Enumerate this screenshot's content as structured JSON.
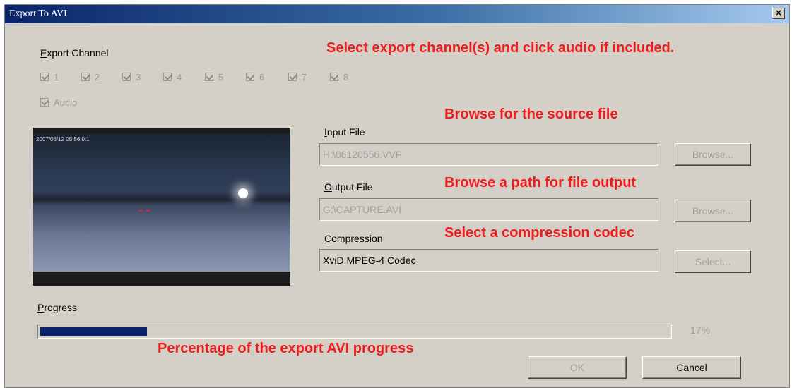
{
  "window": {
    "title": "Export To AVI",
    "close_glyph": "×"
  },
  "export_channel": {
    "label": "Export Channel",
    "channels": [
      "1",
      "2",
      "3",
      "4",
      "5",
      "6",
      "7",
      "8"
    ],
    "audio_label": "Audio"
  },
  "preview": {
    "overlay_text": "2007/06/12 05:56:0:1"
  },
  "input_file": {
    "label": "Input File",
    "value": "H:\\06120556.VVF",
    "browse_label": "Browse..."
  },
  "output_file": {
    "label": "Output File",
    "value": "G:\\CAPTURE.AVI",
    "browse_label": "Browse..."
  },
  "compression": {
    "label": "Compression",
    "value": "XviD MPEG-4 Codec",
    "select_label": "Select..."
  },
  "progress": {
    "label": "Progress",
    "percent_text": "17%",
    "fraction": 0.17,
    "fill_color": "#0a246a"
  },
  "buttons": {
    "ok_label": "OK",
    "cancel_label": "Cancel"
  },
  "annotations": {
    "channel": "Select export channel(s) and click audio if included.",
    "source": "Browse for the source file",
    "output": "Browse a path for file output",
    "codec": "Select a compression codec",
    "progress": "Percentage of the export AVI progress",
    "color": "#ee1c1c"
  }
}
